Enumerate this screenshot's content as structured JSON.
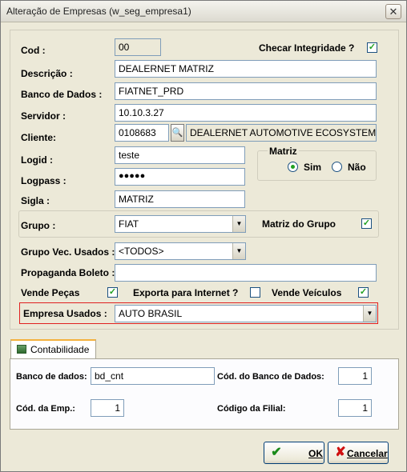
{
  "window": {
    "title": "Alteração de Empresas (w_seg_empresa1)"
  },
  "form": {
    "cod_label": "Cod :",
    "cod_value": "00",
    "checar_label": "Checar Integridade  ?",
    "checar_checked": true,
    "descricao_label": "Descrição :",
    "descricao_value": "DEALERNET MATRIZ",
    "banco_label": "Banco de Dados :",
    "banco_value": "FIATNET_PRD",
    "servidor_label": "Servidor :",
    "servidor_value": "10.10.3.27",
    "cliente_label": "Cliente:",
    "cliente_code": "0108683",
    "cliente_name": "DEALERNET AUTOMOTIVE ECOSYSTEM",
    "logid_label": "Logid :",
    "logid_value": "teste",
    "logpass_label": "Logpass :",
    "logpass_value": "●●●●●",
    "sigla_label": "Sigla :",
    "sigla_value": "MATRIZ",
    "matriz_label": "Matriz",
    "matriz_sim": "Sim",
    "matriz_nao": "Não",
    "matriz_selected": "Sim",
    "grupo_label": "Grupo :",
    "grupo_value": "FIAT",
    "matriz_grupo_label": "Matriz do Grupo",
    "matriz_grupo_checked": true,
    "grupo_vec_label": "Grupo Vec. Usados :",
    "grupo_vec_value": "<TODOS>",
    "propaganda_label": "Propaganda Boleto :",
    "propaganda_value": "",
    "vende_pecas_label": "Vende Peças",
    "vende_pecas_checked": true,
    "exporta_label": "Exporta para Internet ?",
    "exporta_checked": false,
    "vende_veiculos_label": "Vende Veículos",
    "vende_veiculos_checked": true,
    "empresa_usados_label": "Empresa Usados :",
    "empresa_usados_value": "AUTO BRASIL"
  },
  "tabs": [
    {
      "label": "Contabilidade"
    }
  ],
  "contabilidade": {
    "banco_label": "Banco de dados:",
    "banco_value": "bd_cnt",
    "cod_banco_label": "Cód. do Banco de Dados:",
    "cod_banco_value": "1",
    "cod_emp_label": "Cód. da Emp.:",
    "cod_emp_value": "1",
    "cod_filial_label": "Código da Filial:",
    "cod_filial_value": "1"
  },
  "buttons": {
    "ok_label": "OK",
    "cancel_label": "Cancelar"
  },
  "colors": {
    "check_green": "#21a121",
    "highlight_red": "#e02020",
    "tab_orange": "#f4b13d"
  }
}
